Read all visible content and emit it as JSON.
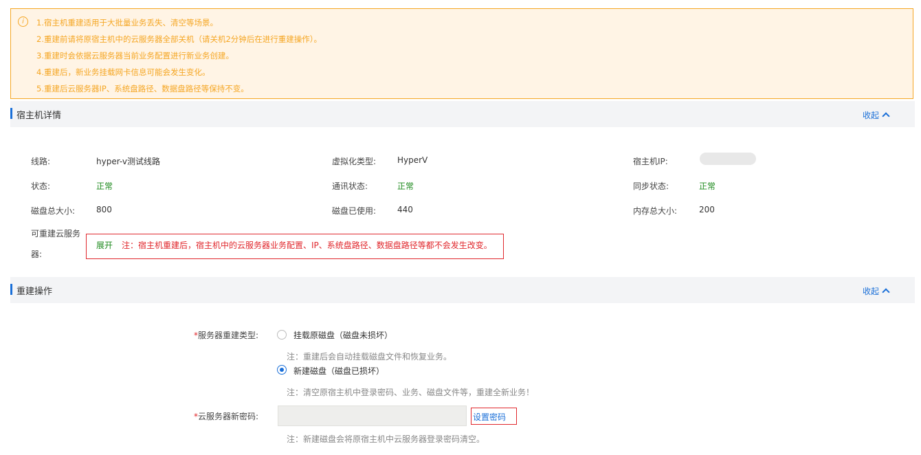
{
  "notice": {
    "icon": "info-icon",
    "lines": [
      "1.宿主机重建适用于大批量业务丢失、清空等场景。",
      "2.重建前请将原宿主机中的云服务器全部关机（请关机2分钟后在进行重建操作）。",
      "3.重建时会依据云服务器当前业务配置进行新业务创建。",
      "4.重建后，新业务挂载网卡信息可能会发生变化。",
      "5.重建后云服务器IP、系统盘路径、数据盘路径等保持不变。"
    ]
  },
  "host_details": {
    "title": "宿主机详情",
    "collapse_label": "收起",
    "fields": {
      "line_label": "线路:",
      "line_value": "hyper-v测试线路",
      "virt_label": "虚拟化类型:",
      "virt_value": "HyperV",
      "ip_label": "宿主机IP:",
      "status_label": "状态:",
      "status_value": "正常",
      "comm_label": "通讯状态:",
      "comm_value": "正常",
      "sync_label": "同步状态:",
      "sync_value": "正常",
      "disk_total_label": "磁盘总大小:",
      "disk_total_value": "800",
      "disk_used_label": "磁盘已使用:",
      "disk_used_value": "440",
      "mem_label": "内存总大小:",
      "mem_value": "200",
      "rebuildable_label_1": "可重建云服务",
      "rebuildable_label_2": "器:",
      "expand_label": "展开",
      "warning": "注：宿主机重建后，宿主机中的云服务器业务配置、IP、系统盘路径、数据盘路径等都不会发生改变。"
    }
  },
  "rebuild": {
    "title": "重建操作",
    "collapse_label": "收起",
    "type_label": "服务器重建类型:",
    "required_mark": "*",
    "options": [
      {
        "label": "挂载原磁盘（磁盘未损坏）",
        "checked": false,
        "hint": "注：重建后会自动挂载磁盘文件和恢复业务。"
      },
      {
        "label": "新建磁盘（磁盘已损坏）",
        "checked": true,
        "hint": "注：清空原宿主机中登录密码、业务、磁盘文件等，重建全新业务！"
      }
    ],
    "password_label": "云服务器新密码:",
    "password_value": "",
    "set_password_label": "设置密码",
    "password_hint": "注：新建磁盘会将原宿主机中云服务器登录密码清空。"
  },
  "colors": {
    "accent": "#1a6fd8",
    "warning": "#f5a623",
    "danger": "#e0262b",
    "success": "#1e8a1e"
  }
}
